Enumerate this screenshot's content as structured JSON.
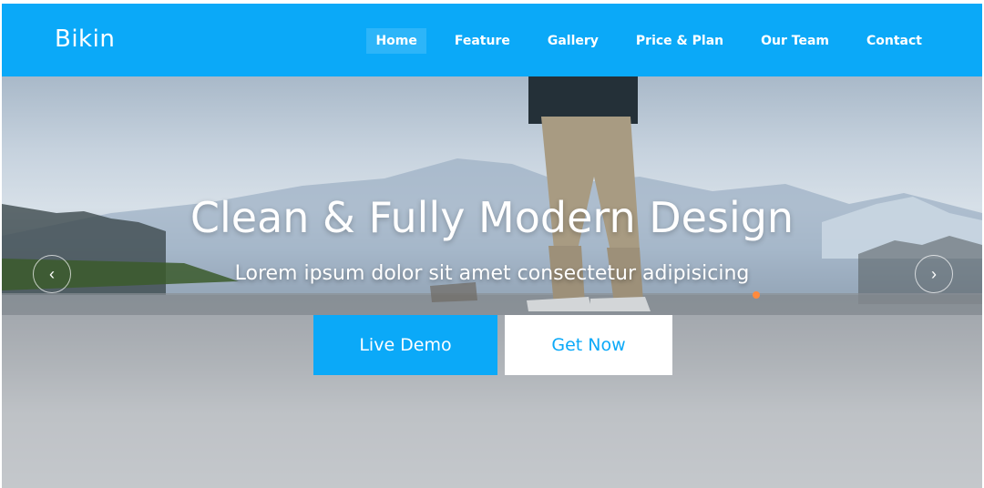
{
  "brand": "Bikin",
  "nav": {
    "items": [
      {
        "label": "Home",
        "active": true
      },
      {
        "label": "Feature"
      },
      {
        "label": "Gallery"
      },
      {
        "label": "Price & Plan"
      },
      {
        "label": "Our Team"
      },
      {
        "label": "Contact"
      }
    ]
  },
  "hero": {
    "title": "Clean & Fully Modern Design",
    "subtitle": "Lorem ipsum dolor sit amet consectetur adipisicing",
    "primary_button": "Live Demo",
    "secondary_button": "Get Now",
    "prev_icon": "chevron-left-icon",
    "next_icon": "chevron-right-icon"
  },
  "colors": {
    "accent": "#0ba9f8",
    "text_light": "#ffffff"
  }
}
